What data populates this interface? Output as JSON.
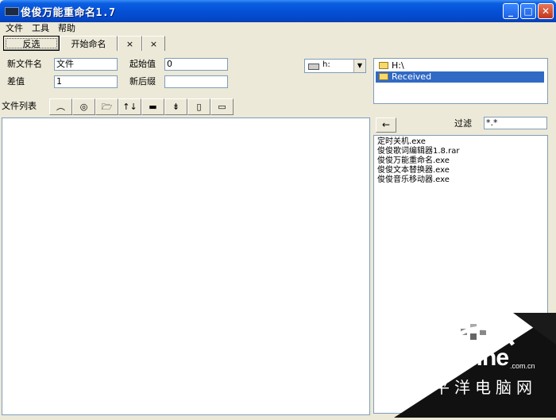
{
  "window": {
    "title": "俊俊万能重命名1.7",
    "min_label": "_",
    "max_label": "□",
    "close_label": "✕"
  },
  "menu": {
    "items": [
      "文件",
      "工具",
      "帮助"
    ]
  },
  "tabs": [
    "反选",
    "开始命名",
    "×",
    "×"
  ],
  "form": {
    "new_name_label": "新文件名",
    "new_name_value": "文件",
    "start_label": "起始值",
    "start_value": "0",
    "diff_label": "差值",
    "diff_value": "1",
    "suffix_label": "新后缀",
    "suffix_value": ""
  },
  "drive": {
    "value": "h:",
    "arrow": "▼"
  },
  "tree": {
    "items": [
      {
        "label": "H:\\",
        "selected": false
      },
      {
        "label": "Received",
        "selected": true
      }
    ]
  },
  "toolbar": {
    "label": "文件列表",
    "buttons": [
      "︵",
      "◎",
      "🗁",
      "↑↓",
      "▬",
      "⇟",
      "▯",
      "▭"
    ]
  },
  "filter": {
    "back": "←",
    "label": "过滤",
    "value": "*.*"
  },
  "files": [
    "定时关机.exe",
    "俊俊歌词编辑器1.8.rar",
    "俊俊万能重命名.exe",
    "俊俊文本替换器.exe",
    "俊俊音乐移动器.exe"
  ],
  "watermark": {
    "brand": "PConline",
    "domain": ".com.cn",
    "cn": "太平洋电脑网"
  }
}
